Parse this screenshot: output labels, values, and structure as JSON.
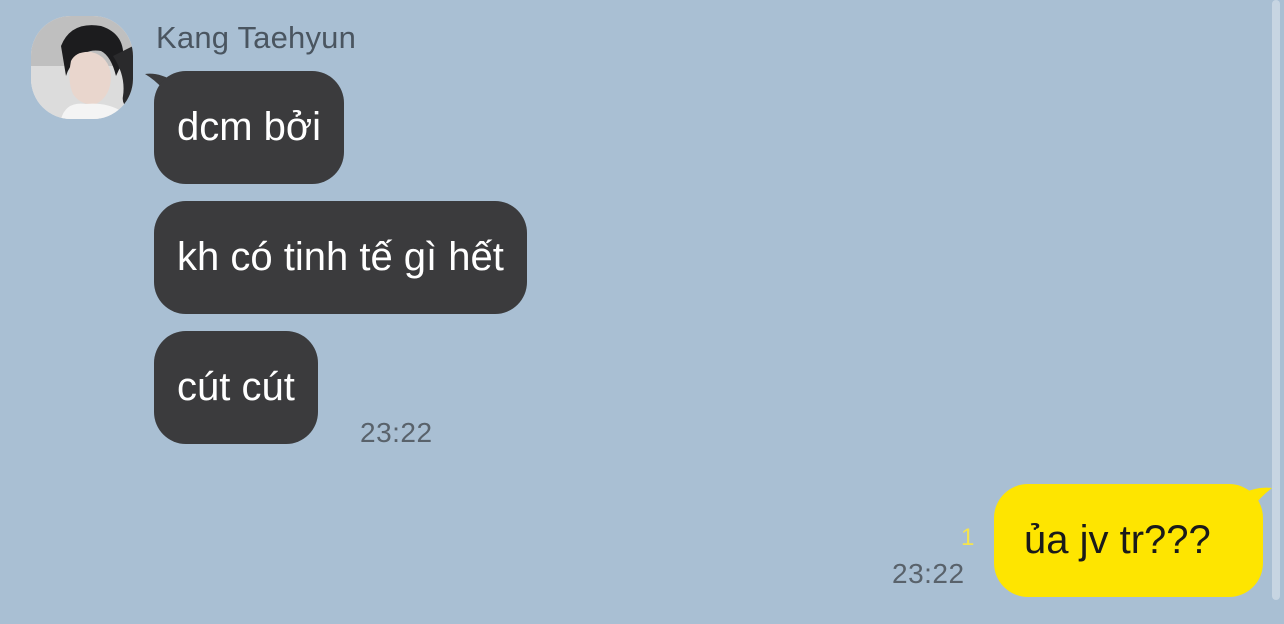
{
  "chat": {
    "sender_name": "Kang Taehyun",
    "incoming": [
      {
        "text": "dcm bởi"
      },
      {
        "text": "kh có tinh tế gì hết"
      },
      {
        "text": "cút cút"
      }
    ],
    "incoming_time": "23:22",
    "outgoing": [
      {
        "text": "ủa jv tr???"
      }
    ],
    "outgoing_unread": "1",
    "outgoing_time": "23:22"
  },
  "colors": {
    "background": "#a9bfd3",
    "incoming_bubble": "#3b3b3d",
    "outgoing_bubble": "#fee500",
    "unread_count": "#f5e44d"
  },
  "icons": {
    "avatar": "profile-photo"
  }
}
